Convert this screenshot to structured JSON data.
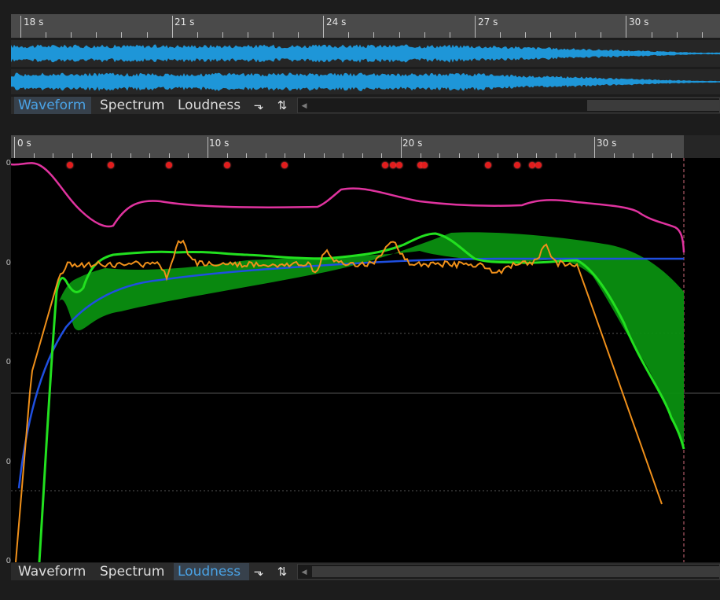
{
  "top_view": {
    "ruler_labels": [
      "18 s",
      "21 s",
      "24 s",
      "27 s",
      "30 s"
    ],
    "tabs": [
      {
        "label": "Waveform",
        "active": true
      },
      {
        "label": "Spectrum",
        "active": false
      },
      {
        "label": "Loudness",
        "active": false
      }
    ],
    "toolbar_icons": [
      "marker-options-icon",
      "swap-updown-icon"
    ],
    "waveform_color": "#1e96d8"
  },
  "bottom_view": {
    "ruler_labels": [
      "0 s",
      "10 s",
      "20 s",
      "30 s"
    ],
    "tabs": [
      {
        "label": "Waveform",
        "active": false
      },
      {
        "label": "Spectrum",
        "active": false
      },
      {
        "label": "Loudness",
        "active": true
      }
    ],
    "toolbar_icons": [
      "marker-options-icon",
      "swap-updown-icon"
    ],
    "y_tick_labels": [
      "0",
      "0",
      "0",
      "0",
      "0"
    ]
  },
  "loudness_curves": {
    "colors": {
      "magenta": "#e0339f",
      "green": "#22e01f",
      "green_band": "#0a8f10",
      "orange": "#f0901a",
      "blue": "#1f4fe0",
      "marker": "#e21d1d"
    },
    "x_unit": "s",
    "markers_s": [
      2.9,
      5.0,
      8.0,
      11.0,
      14.0,
      19.2,
      19.6,
      19.9,
      21.0,
      21.2,
      24.5,
      26.0,
      26.8,
      27.1
    ]
  }
}
